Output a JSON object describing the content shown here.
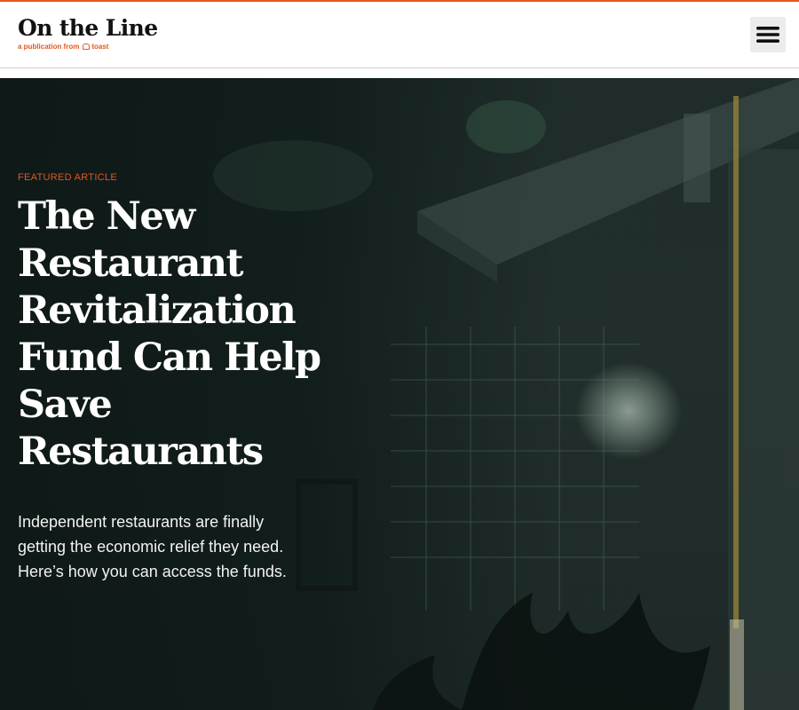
{
  "brand": {
    "title": "On the Line",
    "subtitle": "a publication from",
    "partner": "toast",
    "accent_color": "#e4561f"
  },
  "header": {
    "menu_icon": "hamburger-menu-icon"
  },
  "hero": {
    "eyebrow": "FEATURED ARTICLE",
    "title": "The New Restaurant Revitalization Fund Can Help Save Restaurants",
    "description": "Independent restaurants are finally getting the economic relief they need. Here’s how you can access the funds."
  }
}
